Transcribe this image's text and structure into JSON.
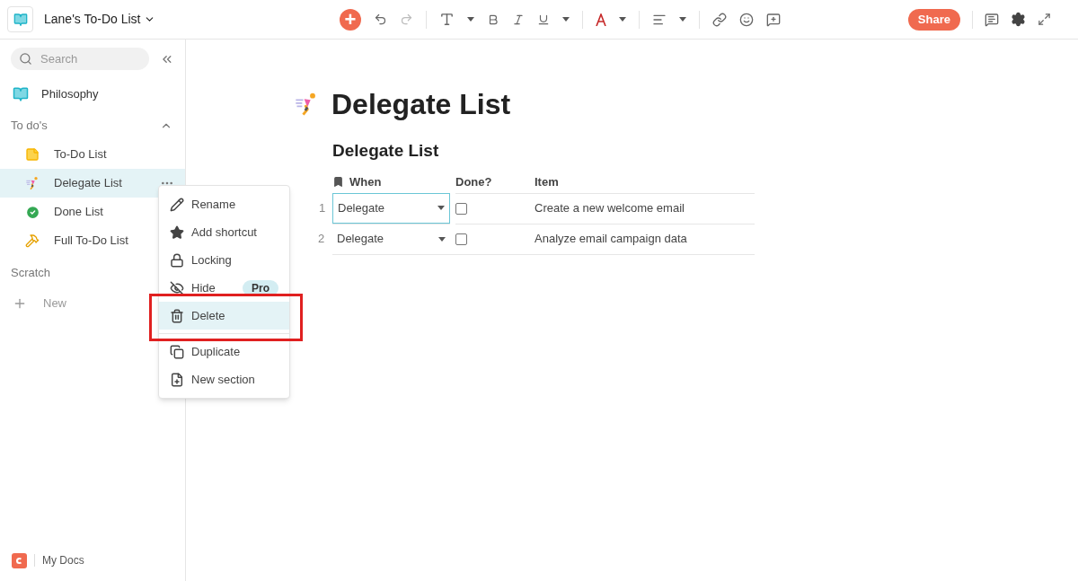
{
  "doc": {
    "title": "Lane's To-Do List"
  },
  "toolbar": {
    "insert": "+"
  },
  "share": "Share",
  "sidebar": {
    "search": {
      "placeholder": "Search"
    },
    "top_items": [
      {
        "label": "Philosophy",
        "kind": "book",
        "selected": false
      }
    ],
    "sections": [
      {
        "title": "To do's",
        "expanded": true,
        "items": [
          {
            "label": "To-Do List",
            "kind": "note",
            "selected": false
          },
          {
            "label": "Delegate List",
            "kind": "runner",
            "selected": true
          },
          {
            "label": "Done List",
            "kind": "check",
            "selected": false
          },
          {
            "label": "Full To-Do List",
            "kind": "hammer",
            "selected": false
          }
        ]
      },
      {
        "title": "Scratch"
      }
    ],
    "new": "New",
    "footer": "My Docs"
  },
  "menu": {
    "items": [
      {
        "label": "Rename",
        "kind": "pencil",
        "selected": false,
        "annotated": false
      },
      {
        "label": "Add shortcut",
        "kind": "star",
        "selected": false,
        "annotated": false
      },
      {
        "label": "Locking",
        "kind": "lock",
        "selected": false,
        "annotated": false
      },
      {
        "label": "Hide",
        "kind": "eye-off",
        "selected": false,
        "annotated": false,
        "badge": "Pro"
      },
      {
        "label": "Delete",
        "kind": "trash",
        "selected": true,
        "annotated": true
      },
      {
        "label": "Duplicate",
        "kind": "copy",
        "selected": false,
        "annotated": false
      },
      {
        "label": "New section",
        "kind": "section",
        "selected": false,
        "annotated": false
      }
    ]
  },
  "page": {
    "title": "Delegate List",
    "table": {
      "title": "Delegate List",
      "columns": [
        "When",
        "Done?",
        "Item"
      ],
      "rows": [
        {
          "number": "1",
          "when": "Delegate",
          "done": false,
          "item": "Create a new welcome email",
          "selected": true
        },
        {
          "number": "2",
          "when": "Delegate",
          "done": false,
          "item": "Analyze email campaign data",
          "selected": false
        }
      ]
    }
  }
}
